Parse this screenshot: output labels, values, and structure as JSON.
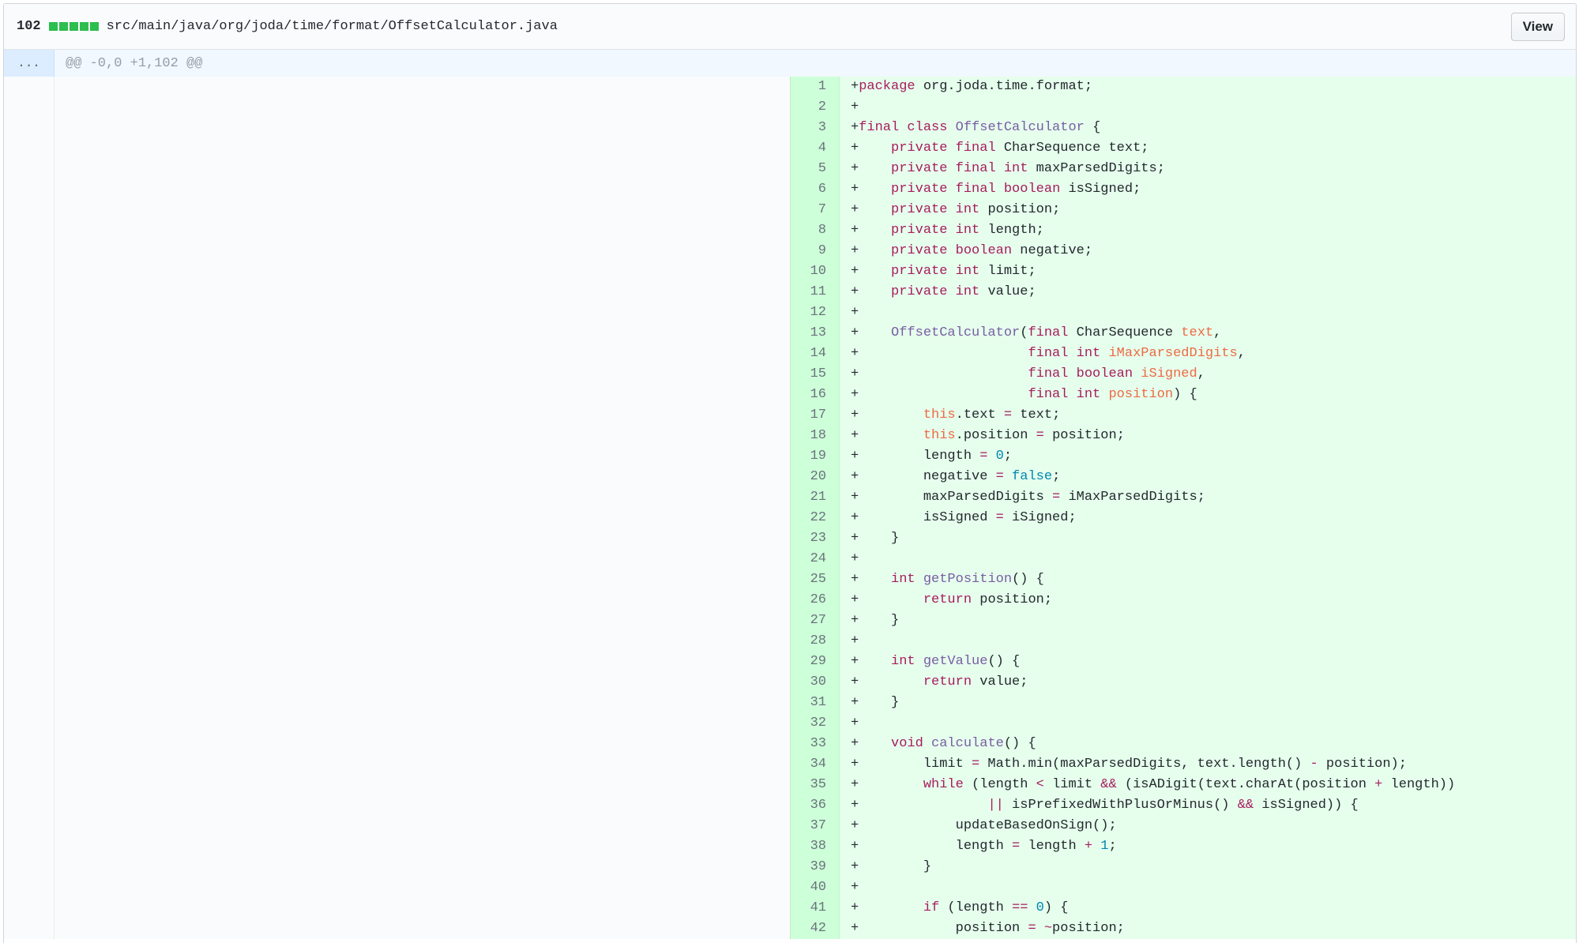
{
  "file": {
    "additions": "102",
    "path": "src/main/java/org/joda/time/format/OffsetCalculator.java",
    "view_label": "View"
  },
  "hunk": {
    "expand": "...",
    "header": "@@ -0,0 +1,102 @@"
  },
  "colors": {
    "addition_line_bg": "#e6ffed",
    "addition_num_bg": "#cdffd8",
    "keyword": "#a71d5d",
    "entity": "#795da3",
    "variable": "#ed6a43",
    "constant": "#0086b3",
    "diffstat_green": "#2cbe4e"
  },
  "lines": [
    {
      "n": "1",
      "t": [
        [
          "+",
          ""
        ],
        [
          "package",
          "k"
        ],
        [
          " org.joda.time.format;",
          ""
        ]
      ]
    },
    {
      "n": "2",
      "t": [
        [
          "+",
          ""
        ]
      ]
    },
    {
      "n": "3",
      "t": [
        [
          "+",
          ""
        ],
        [
          "final",
          "k"
        ],
        [
          " ",
          ""
        ],
        [
          "class",
          "k"
        ],
        [
          " ",
          ""
        ],
        [
          "OffsetCalculator",
          "en"
        ],
        [
          " {",
          ""
        ]
      ]
    },
    {
      "n": "4",
      "t": [
        [
          "+    ",
          ""
        ],
        [
          "private",
          "k"
        ],
        [
          " ",
          ""
        ],
        [
          "final",
          "k"
        ],
        [
          " CharSequence text;",
          ""
        ]
      ]
    },
    {
      "n": "5",
      "t": [
        [
          "+    ",
          ""
        ],
        [
          "private",
          "k"
        ],
        [
          " ",
          ""
        ],
        [
          "final",
          "k"
        ],
        [
          " ",
          ""
        ],
        [
          "int",
          "k"
        ],
        [
          " maxParsedDigits;",
          ""
        ]
      ]
    },
    {
      "n": "6",
      "t": [
        [
          "+    ",
          ""
        ],
        [
          "private",
          "k"
        ],
        [
          " ",
          ""
        ],
        [
          "final",
          "k"
        ],
        [
          " ",
          ""
        ],
        [
          "boolean",
          "k"
        ],
        [
          " isSigned;",
          ""
        ]
      ]
    },
    {
      "n": "7",
      "t": [
        [
          "+    ",
          ""
        ],
        [
          "private",
          "k"
        ],
        [
          " ",
          ""
        ],
        [
          "int",
          "k"
        ],
        [
          " position;",
          ""
        ]
      ]
    },
    {
      "n": "8",
      "t": [
        [
          "+    ",
          ""
        ],
        [
          "private",
          "k"
        ],
        [
          " ",
          ""
        ],
        [
          "int",
          "k"
        ],
        [
          " length;",
          ""
        ]
      ]
    },
    {
      "n": "9",
      "t": [
        [
          "+    ",
          ""
        ],
        [
          "private",
          "k"
        ],
        [
          " ",
          ""
        ],
        [
          "boolean",
          "k"
        ],
        [
          " negative;",
          ""
        ]
      ]
    },
    {
      "n": "10",
      "t": [
        [
          "+    ",
          ""
        ],
        [
          "private",
          "k"
        ],
        [
          " ",
          ""
        ],
        [
          "int",
          "k"
        ],
        [
          " limit;",
          ""
        ]
      ]
    },
    {
      "n": "11",
      "t": [
        [
          "+    ",
          ""
        ],
        [
          "private",
          "k"
        ],
        [
          " ",
          ""
        ],
        [
          "int",
          "k"
        ],
        [
          " value;",
          ""
        ]
      ]
    },
    {
      "n": "12",
      "t": [
        [
          "+",
          ""
        ]
      ]
    },
    {
      "n": "13",
      "t": [
        [
          "+    ",
          ""
        ],
        [
          "OffsetCalculator",
          "en"
        ],
        [
          "(",
          ""
        ],
        [
          "final",
          "k"
        ],
        [
          " CharSequence ",
          ""
        ],
        [
          "text",
          "v"
        ],
        [
          ",",
          ""
        ]
      ]
    },
    {
      "n": "14",
      "t": [
        [
          "+                     ",
          ""
        ],
        [
          "final",
          "k"
        ],
        [
          " ",
          ""
        ],
        [
          "int",
          "k"
        ],
        [
          " ",
          ""
        ],
        [
          "iMaxParsedDigits",
          "v"
        ],
        [
          ",",
          ""
        ]
      ]
    },
    {
      "n": "15",
      "t": [
        [
          "+                     ",
          ""
        ],
        [
          "final",
          "k"
        ],
        [
          " ",
          ""
        ],
        [
          "boolean",
          "k"
        ],
        [
          " ",
          ""
        ],
        [
          "iSigned",
          "v"
        ],
        [
          ",",
          ""
        ]
      ]
    },
    {
      "n": "16",
      "t": [
        [
          "+                     ",
          ""
        ],
        [
          "final",
          "k"
        ],
        [
          " ",
          ""
        ],
        [
          "int",
          "k"
        ],
        [
          " ",
          ""
        ],
        [
          "position",
          "v"
        ],
        [
          ") {",
          ""
        ]
      ]
    },
    {
      "n": "17",
      "t": [
        [
          "+        ",
          ""
        ],
        [
          "this",
          "v"
        ],
        [
          ".text ",
          ""
        ],
        [
          "=",
          "k"
        ],
        [
          " text;",
          ""
        ]
      ]
    },
    {
      "n": "18",
      "t": [
        [
          "+        ",
          ""
        ],
        [
          "this",
          "v"
        ],
        [
          ".position ",
          ""
        ],
        [
          "=",
          "k"
        ],
        [
          " position;",
          ""
        ]
      ]
    },
    {
      "n": "19",
      "t": [
        [
          "+        length ",
          ""
        ],
        [
          "=",
          "k"
        ],
        [
          " ",
          ""
        ],
        [
          "0",
          "c1"
        ],
        [
          ";",
          ""
        ]
      ]
    },
    {
      "n": "20",
      "t": [
        [
          "+        negative ",
          ""
        ],
        [
          "=",
          "k"
        ],
        [
          " ",
          ""
        ],
        [
          "false",
          "c1"
        ],
        [
          ";",
          ""
        ]
      ]
    },
    {
      "n": "21",
      "t": [
        [
          "+        maxParsedDigits ",
          ""
        ],
        [
          "=",
          "k"
        ],
        [
          " iMaxParsedDigits;",
          ""
        ]
      ]
    },
    {
      "n": "22",
      "t": [
        [
          "+        isSigned ",
          ""
        ],
        [
          "=",
          "k"
        ],
        [
          " iSigned;",
          ""
        ]
      ]
    },
    {
      "n": "23",
      "t": [
        [
          "+    }",
          ""
        ]
      ]
    },
    {
      "n": "24",
      "t": [
        [
          "+",
          ""
        ]
      ]
    },
    {
      "n": "25",
      "t": [
        [
          "+    ",
          ""
        ],
        [
          "int",
          "k"
        ],
        [
          " ",
          ""
        ],
        [
          "getPosition",
          "en"
        ],
        [
          "() {",
          ""
        ]
      ]
    },
    {
      "n": "26",
      "t": [
        [
          "+        ",
          ""
        ],
        [
          "return",
          "k"
        ],
        [
          " position;",
          ""
        ]
      ]
    },
    {
      "n": "27",
      "t": [
        [
          "+    }",
          ""
        ]
      ]
    },
    {
      "n": "28",
      "t": [
        [
          "+",
          ""
        ]
      ]
    },
    {
      "n": "29",
      "t": [
        [
          "+    ",
          ""
        ],
        [
          "int",
          "k"
        ],
        [
          " ",
          ""
        ],
        [
          "getValue",
          "en"
        ],
        [
          "() {",
          ""
        ]
      ]
    },
    {
      "n": "30",
      "t": [
        [
          "+        ",
          ""
        ],
        [
          "return",
          "k"
        ],
        [
          " value;",
          ""
        ]
      ]
    },
    {
      "n": "31",
      "t": [
        [
          "+    }",
          ""
        ]
      ]
    },
    {
      "n": "32",
      "t": [
        [
          "+",
          ""
        ]
      ]
    },
    {
      "n": "33",
      "t": [
        [
          "+    ",
          ""
        ],
        [
          "void",
          "k"
        ],
        [
          " ",
          ""
        ],
        [
          "calculate",
          "en"
        ],
        [
          "() {",
          ""
        ]
      ]
    },
    {
      "n": "34",
      "t": [
        [
          "+        limit ",
          ""
        ],
        [
          "=",
          "k"
        ],
        [
          " Math.min(maxParsedDigits, text.length() ",
          ""
        ],
        [
          "-",
          "k"
        ],
        [
          " position);",
          ""
        ]
      ]
    },
    {
      "n": "35",
      "t": [
        [
          "+        ",
          ""
        ],
        [
          "while",
          "k"
        ],
        [
          " (length ",
          ""
        ],
        [
          "<",
          "k"
        ],
        [
          " limit ",
          ""
        ],
        [
          "&&",
          "k"
        ],
        [
          " (isADigit(text.charAt(position ",
          ""
        ],
        [
          "+",
          "k"
        ],
        [
          " length))",
          ""
        ]
      ]
    },
    {
      "n": "36",
      "t": [
        [
          "+                ",
          ""
        ],
        [
          "||",
          "k"
        ],
        [
          " isPrefixedWithPlusOrMinus() ",
          ""
        ],
        [
          "&&",
          "k"
        ],
        [
          " isSigned)) {",
          ""
        ]
      ]
    },
    {
      "n": "37",
      "t": [
        [
          "+            updateBasedOnSign();",
          ""
        ]
      ]
    },
    {
      "n": "38",
      "t": [
        [
          "+            length ",
          ""
        ],
        [
          "=",
          "k"
        ],
        [
          " length ",
          ""
        ],
        [
          "+",
          "k"
        ],
        [
          " ",
          ""
        ],
        [
          "1",
          "c1"
        ],
        [
          ";",
          ""
        ]
      ]
    },
    {
      "n": "39",
      "t": [
        [
          "+        }",
          ""
        ]
      ]
    },
    {
      "n": "40",
      "t": [
        [
          "+",
          ""
        ]
      ]
    },
    {
      "n": "41",
      "t": [
        [
          "+        ",
          ""
        ],
        [
          "if",
          "k"
        ],
        [
          " (length ",
          ""
        ],
        [
          "==",
          "k"
        ],
        [
          " ",
          ""
        ],
        [
          "0",
          "c1"
        ],
        [
          ") {",
          ""
        ]
      ]
    },
    {
      "n": "42",
      "t": [
        [
          "+            position ",
          ""
        ],
        [
          "=",
          "k"
        ],
        [
          " ",
          ""
        ],
        [
          "~",
          "k"
        ],
        [
          "position;",
          ""
        ]
      ]
    }
  ]
}
